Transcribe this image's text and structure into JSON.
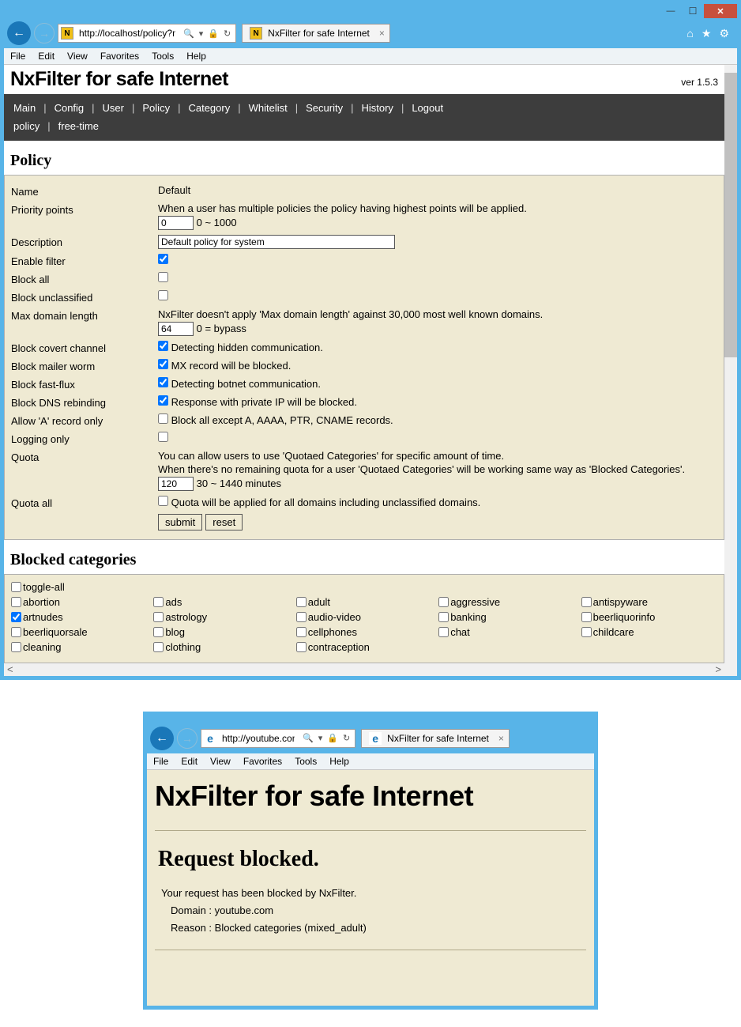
{
  "win1": {
    "url": "http://localhost/policy?mod",
    "tab_title": "NxFilter for safe Internet",
    "menus": [
      "File",
      "Edit",
      "View",
      "Favorites",
      "Tools",
      "Help"
    ],
    "page_title": "NxFilter for safe Internet",
    "version": "ver 1.5.3",
    "nav": [
      "Main",
      "Config",
      "User",
      "Policy",
      "Category",
      "Whitelist",
      "Security",
      "History",
      "Logout"
    ],
    "bread": [
      "policy",
      "free-time"
    ],
    "section1": "Policy",
    "form": {
      "name_lbl": "Name",
      "name_val": "Default",
      "prio_lbl": "Priority points",
      "prio_note": "When a user has multiple policies the policy having highest points will be applied.",
      "prio_val": "0",
      "prio_range": "0 ~ 1000",
      "desc_lbl": "Description",
      "desc_val": "Default policy for system",
      "enable_lbl": "Enable filter",
      "blockall_lbl": "Block all",
      "blockunc_lbl": "Block unclassified",
      "maxdom_lbl": "Max domain length",
      "maxdom_note": "NxFilter doesn't apply 'Max domain length' against 30,000 most well known domains.",
      "maxdom_val": "64",
      "maxdom_suffix": "0 = bypass",
      "covert_lbl": "Block covert channel",
      "covert_txt": "Detecting hidden communication.",
      "mailer_lbl": "Block mailer worm",
      "mailer_txt": "MX record will be blocked.",
      "fastflux_lbl": "Block fast-flux",
      "fastflux_txt": "Detecting botnet communication.",
      "dnsreb_lbl": "Block DNS rebinding",
      "dnsreb_txt": "Response with private IP will be blocked.",
      "arec_lbl": "Allow 'A' record only",
      "arec_txt": "Block all except A, AAAA, PTR, CNAME records.",
      "logonly_lbl": "Logging only",
      "quota_lbl": "Quota",
      "quota_note1": "You can allow users to use 'Quotaed Categories' for specific amount of time.",
      "quota_note2": "When there's no remaining quota for a user 'Quotaed Categories' will be working same way as 'Blocked Categories'.",
      "quota_val": "120",
      "quota_suffix": "30 ~ 1440 minutes",
      "quotaall_lbl": "Quota all",
      "quotaall_txt": "Quota will be applied for all domains including unclassified domains.",
      "submit": "submit",
      "reset": "reset"
    },
    "section2": "Blocked categories",
    "cats": [
      {
        "l": "toggle-all",
        "c": false
      },
      {
        "l": "abortion",
        "c": false
      },
      {
        "l": "ads",
        "c": false
      },
      {
        "l": "adult",
        "c": false
      },
      {
        "l": "aggressive",
        "c": false
      },
      {
        "l": "antispyware",
        "c": false
      },
      {
        "l": "artnudes",
        "c": true
      },
      {
        "l": "astrology",
        "c": false
      },
      {
        "l": "audio-video",
        "c": false
      },
      {
        "l": "banking",
        "c": false
      },
      {
        "l": "beerliquorinfo",
        "c": false
      },
      {
        "l": "beerliquorsale",
        "c": false
      },
      {
        "l": "blog",
        "c": false
      },
      {
        "l": "cellphones",
        "c": false
      },
      {
        "l": "chat",
        "c": false
      },
      {
        "l": "childcare",
        "c": false
      },
      {
        "l": "cleaning",
        "c": false
      },
      {
        "l": "clothing",
        "c": false
      },
      {
        "l": "contraception",
        "c": false
      }
    ]
  },
  "win2": {
    "url": "http://youtube.com/",
    "tab_title": "NxFilter for safe Internet",
    "menus": [
      "File",
      "Edit",
      "View",
      "Favorites",
      "Tools",
      "Help"
    ],
    "page_title": "NxFilter for safe Internet",
    "blocked_h": "Request blocked.",
    "blocked_msg": "Your request has been blocked by NxFilter.",
    "domain": "Domain : youtube.com",
    "reason": "Reason : Blocked categories (mixed_adult)"
  }
}
